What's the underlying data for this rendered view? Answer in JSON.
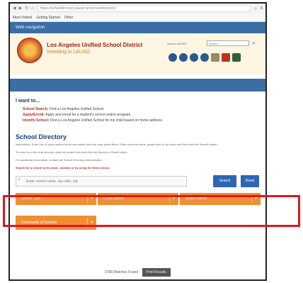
{
  "browser": {
    "url": "https://schooldirectory.lausd.net/schooldirectory/",
    "bookmarks": [
      "Most Visited",
      "Getting Started",
      "Other"
    ]
  },
  "site": {
    "top_label": "Web navigation",
    "district_name": "Los Angeles Unified School District",
    "tagline": "Investing in LAUSD",
    "search_label": "Search LAUSD",
    "search_placeholder": "Search"
  },
  "iwant": {
    "title": "I want to...",
    "items": [
      {
        "lead": "School Search:",
        "text": "Find a Los Angeles Unified School."
      },
      {
        "lead": "Apply/Enroll:",
        "text": "Apply and enroll for a student's school and/or program."
      },
      {
        "lead": "Identify School:",
        "text": "Find a Los Angeles Unified School for my child based on home address."
      }
    ]
  },
  "directory": {
    "title": "School Directory",
    "paragraphs": [
      "Instructions: Enter one or more search terms and select from the drop-down filters. Enter a school name, grade level or zip code and then click the Search button.",
      "To return to a list of all schools, clear the search box and click the Search or Reset button.",
      "For additional information, contact the School Directory Administrator."
    ],
    "link_text": "Search for a school by its name, location or by using the filters below.",
    "search_placeholder": "Enter school name, zip code, city",
    "search_button": "Search",
    "reset_button": "Reset",
    "filters": [
      "School Type",
      "Local District",
      "Board District"
    ],
    "filter_row2": [
      "Community of Schools"
    ]
  },
  "footer": {
    "found_text": "1000 Matches Found",
    "print_button": "Print Results"
  },
  "colors": {
    "brand_blue": "#3a6ea5",
    "button_blue": "#2e66b5",
    "filter_orange": "#ef8e33",
    "highlight_red": "#e3151e",
    "district_red": "#a0201a"
  },
  "icons": [
    "back-icon",
    "forward-icon",
    "refresh-icon",
    "home-icon",
    "search-icon",
    "facebook-icon",
    "twitter-icon",
    "youtube-icon",
    "instagram-icon"
  ]
}
